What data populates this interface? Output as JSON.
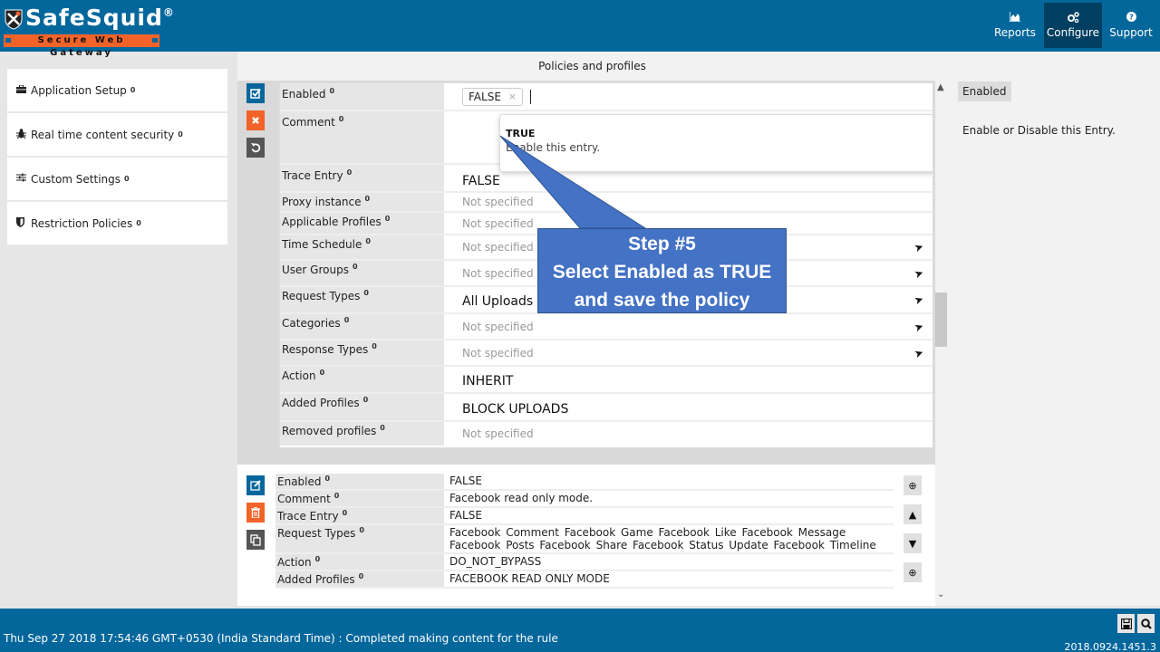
{
  "header": {
    "logo_title": "SafeSquid",
    "logo_reg": "®",
    "logo_tagline": "Secure Web Gateway",
    "nav": [
      {
        "label": "Reports",
        "icon": "chart-icon",
        "active": false
      },
      {
        "label": "Configure",
        "icon": "cogs-icon",
        "active": true
      },
      {
        "label": "Support",
        "icon": "question-icon",
        "active": false
      }
    ]
  },
  "sidebar": {
    "items": [
      {
        "label": "Application Setup",
        "icon": "briefcase-icon"
      },
      {
        "label": "Real time content security",
        "icon": "bug-icon"
      },
      {
        "label": "Custom Settings",
        "icon": "sliders-icon"
      },
      {
        "label": "Restriction Policies",
        "icon": "shield-icon"
      }
    ],
    "info_glyph": "0"
  },
  "main": {
    "title": "Policies and profiles",
    "editor": {
      "fields": [
        {
          "label": "Enabled",
          "type": "tag",
          "value": "FALSE"
        },
        {
          "label": "Comment",
          "type": "text",
          "value": ""
        },
        {
          "label": "Trace Entry",
          "type": "text",
          "value": "FALSE"
        },
        {
          "label": "Proxy instance",
          "type": "ns",
          "value": "Not specified"
        },
        {
          "label": "Applicable Profiles",
          "type": "ns",
          "value": "Not specified"
        },
        {
          "label": "Time Schedule",
          "type": "ns",
          "value": "Not specified",
          "send": true
        },
        {
          "label": "User Groups",
          "type": "ns",
          "value": "Not specified",
          "send": true
        },
        {
          "label": "Request Types",
          "type": "text",
          "value": "All Uploads",
          "send": true
        },
        {
          "label": "Categories",
          "type": "ns",
          "value": "Not specified",
          "send": true
        },
        {
          "label": "Response Types",
          "type": "ns",
          "value": "Not specified",
          "send": true
        },
        {
          "label": "Action",
          "type": "text",
          "value": "INHERIT"
        },
        {
          "label": "Added Profiles",
          "type": "text",
          "value": "BLOCK UPLOADS"
        },
        {
          "label": "Removed profiles",
          "type": "ns",
          "value": "Not specified"
        }
      ],
      "dropdown": {
        "option": "TRUE",
        "description": "Enable this entry."
      }
    },
    "list": {
      "rows": [
        {
          "label": "Enabled",
          "value": "FALSE"
        },
        {
          "label": "Comment",
          "value": "Facebook read only mode."
        },
        {
          "label": "Trace Entry",
          "value": "FALSE"
        },
        {
          "label": "Request Types",
          "value": "Facebook Comment  Facebook Game  Facebook Like  Facebook Message  Facebook Posts  Facebook Share  Facebook Status Update  Facebook Timeline"
        },
        {
          "label": "Action",
          "value": "DO_NOT_BYPASS"
        },
        {
          "label": "Added Profiles",
          "value": "FACEBOOK READ ONLY MODE"
        }
      ]
    }
  },
  "help": {
    "title": "Enabled",
    "text": "Enable or Disable this Entry."
  },
  "footer": {
    "status": "Thu Sep 27 2018 17:54:46 GMT+0530 (India Standard Time) : Completed making content for the rule",
    "version": "2018.0924.1451.3"
  },
  "callout": {
    "line1": "Step #5",
    "line2": "Select Enabled as TRUE",
    "line3": "and save the policy",
    "color": "#4472c4"
  }
}
